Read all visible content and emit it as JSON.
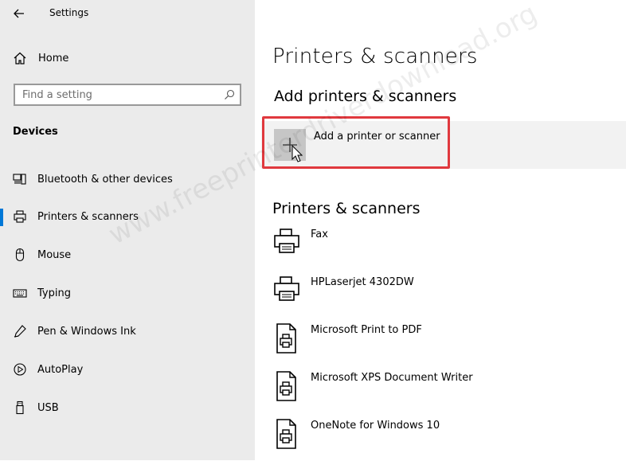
{
  "titlebar": {
    "title": "Settings"
  },
  "sidebar": {
    "home_label": "Home",
    "search_placeholder": "Find a setting",
    "section_title": "Devices",
    "items": [
      {
        "label": "Bluetooth & other devices",
        "icon": "bluetooth-devices-icon"
      },
      {
        "label": "Printers & scanners",
        "icon": "printer-icon"
      },
      {
        "label": "Mouse",
        "icon": "mouse-icon"
      },
      {
        "label": "Typing",
        "icon": "keyboard-icon"
      },
      {
        "label": "Pen & Windows Ink",
        "icon": "pen-icon"
      },
      {
        "label": "AutoPlay",
        "icon": "autoplay-icon"
      },
      {
        "label": "USB",
        "icon": "usb-icon"
      }
    ],
    "active_index": 1
  },
  "main": {
    "page_title": "Printers & scanners",
    "add_section_title": "Add printers & scanners",
    "add_button_label": "Add a printer or scanner",
    "list_title": "Printers & scanners",
    "printers": [
      {
        "name": "Fax",
        "icon": "printer-icon"
      },
      {
        "name": "HPLaserjet 4302DW",
        "icon": "printer-icon"
      },
      {
        "name": "Microsoft Print to PDF",
        "icon": "document-printer-icon"
      },
      {
        "name": "Microsoft XPS Document Writer",
        "icon": "document-printer-icon"
      },
      {
        "name": "OneNote for Windows 10",
        "icon": "document-printer-icon"
      }
    ]
  },
  "watermark": "www.freeprinterdriverdownload.org",
  "colors": {
    "sidebar_bg": "#ebebeb",
    "accent": "#0078d7",
    "highlight": "#e0393e"
  }
}
